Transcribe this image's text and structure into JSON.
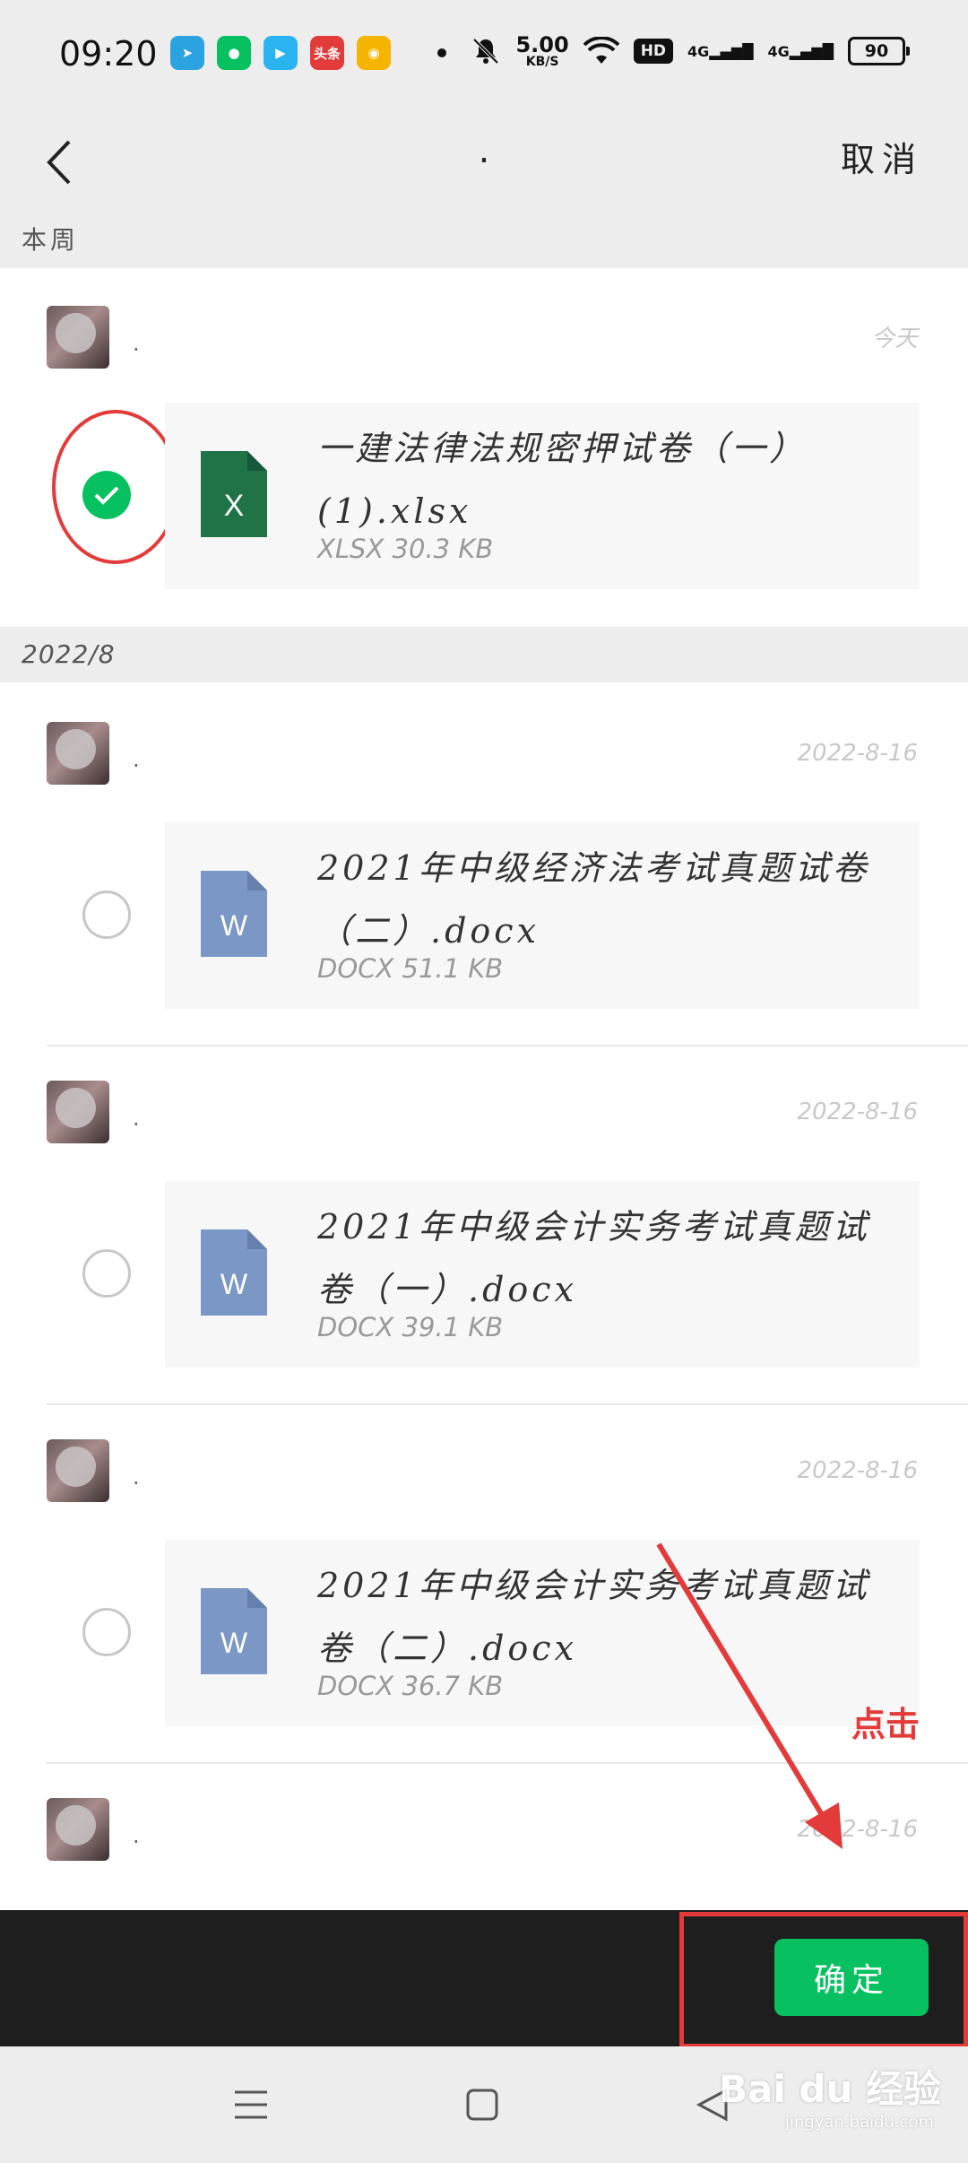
{
  "status_bar": {
    "time": "09:20",
    "apps": [
      {
        "icon": "telegram-icon",
        "color": "#2aa3e0",
        "text": ""
      },
      {
        "icon": "wechat-icon",
        "color": "#07c160",
        "text": ""
      },
      {
        "icon": "video-icon",
        "color": "#29b3f0",
        "text": ""
      },
      {
        "icon": "toutiao-icon",
        "color": "#e33a3a",
        "text": "头条"
      },
      {
        "icon": "weibo-icon",
        "color": "#f5b400",
        "text": ""
      }
    ],
    "speed_value": "5.00",
    "speed_unit": "KB/S",
    "hd": "HD",
    "signal1": "4G",
    "signal2": "4G",
    "battery": "90"
  },
  "nav": {
    "title": ".",
    "cancel": "取消"
  },
  "sections": [
    {
      "label": "本周"
    },
    {
      "label": "2022/8"
    }
  ],
  "messages": [
    {
      "sender": ".",
      "date": "今天",
      "file_name": "一建法律法规密押试卷（一）(1).xlsx",
      "file_meta": "XLSX 30.3 KB",
      "type": "xlsx",
      "checked": true
    },
    {
      "sender": ".",
      "date": "2022-8-16",
      "file_name": "2021年中级经济法考试真题试卷（二）.docx",
      "file_meta": "DOCX 51.1 KB",
      "type": "docx",
      "checked": false
    },
    {
      "sender": ".",
      "date": "2022-8-16",
      "file_name": "2021年中级会计实务考试真题试卷（一）.docx",
      "file_meta": "DOCX 39.1 KB",
      "type": "docx",
      "checked": false
    },
    {
      "sender": ".",
      "date": "2022-8-16",
      "file_name": "2021年中级会计实务考试真题试卷（二）.docx",
      "file_meta": "DOCX 36.7 KB",
      "type": "docx",
      "checked": false
    },
    {
      "sender": ".",
      "date": "2022-8-16"
    }
  ],
  "action": {
    "confirm": "确定"
  },
  "annotation": {
    "click_note": "点击"
  },
  "watermark": {
    "brand": "Bai du 经验",
    "site": "jingyan.baidu.com"
  },
  "colors": {
    "wechat_green": "#07c160",
    "excel_green": "#1f7346",
    "word_blue": "#7b97c6",
    "annotation_red": "#e33a3a"
  }
}
